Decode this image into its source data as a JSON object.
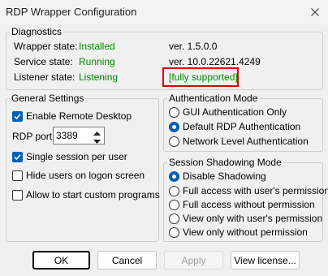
{
  "window": {
    "title": "RDP Wrapper Configuration"
  },
  "diagnostics": {
    "title": "Diagnostics",
    "wrapper_label": "Wrapper state:",
    "wrapper_value": "Installed",
    "service_label": "Service state:",
    "service_value": "Running",
    "listener_label": "Listener state:",
    "listener_value": "Listening",
    "wrapper_version": "ver.  1.5.0.0",
    "service_version": "ver.  10.0.22621.4249",
    "support_status": "[fully supported]"
  },
  "general": {
    "title": "General Settings",
    "enable_rdp": {
      "label": "Enable Remote Desktop",
      "checked": true
    },
    "port_label": "RDP port:",
    "port_value": "3389",
    "single_session": {
      "label": "Single session per user",
      "checked": true
    },
    "hide_users": {
      "label": "Hide users on logon screen",
      "checked": false
    },
    "custom_programs": {
      "label": "Allow to start custom programs",
      "checked": false
    }
  },
  "auth": {
    "title": "Authentication Mode",
    "options": [
      {
        "label": "GUI Authentication Only",
        "selected": false
      },
      {
        "label": "Default RDP Authentication",
        "selected": true
      },
      {
        "label": "Network Level Authentication",
        "selected": false
      }
    ]
  },
  "shadow": {
    "title": "Session Shadowing Mode",
    "options": [
      {
        "label": "Disable Shadowing",
        "selected": true
      },
      {
        "label": "Full access with user's permission",
        "selected": false
      },
      {
        "label": "Full access without permission",
        "selected": false
      },
      {
        "label": "View only with user's permission",
        "selected": false
      },
      {
        "label": "View only without permission",
        "selected": false
      }
    ]
  },
  "buttons": {
    "ok": "OK",
    "cancel": "Cancel",
    "apply": "Apply",
    "view_license": "View license..."
  },
  "colors": {
    "status_green": "#008a00",
    "highlight_red": "#e00000",
    "accent_blue": "#005fb8"
  }
}
